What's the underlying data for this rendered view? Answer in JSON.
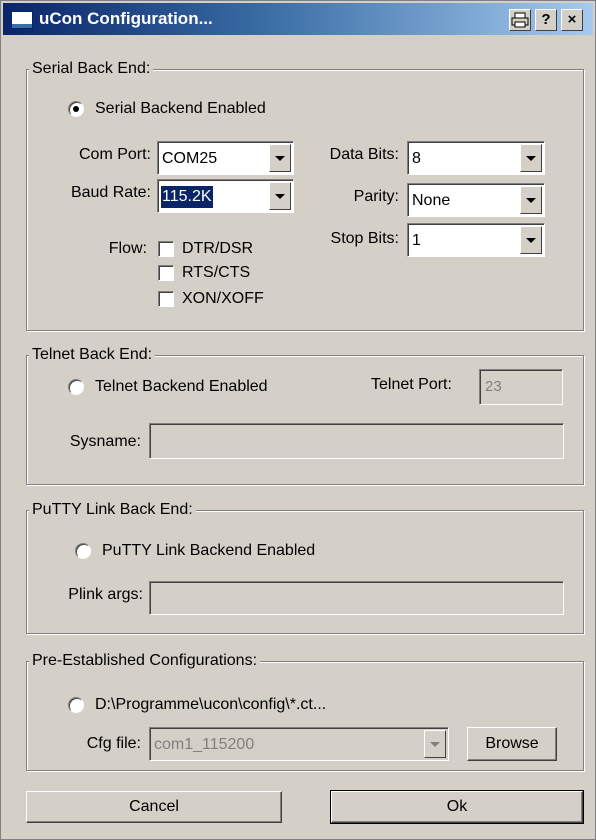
{
  "window": {
    "title": "uCon Configuration...",
    "help_label": "?",
    "close_label": "×"
  },
  "serial": {
    "legend": "Serial Back End:",
    "enable_label": "Serial Backend Enabled",
    "enabled": true,
    "com_port_label": "Com Port:",
    "com_port_value": "COM25",
    "baud_label": "Baud Rate:",
    "baud_value": "115.2K",
    "flow_label": "Flow:",
    "flow_options": [
      "DTR/DSR",
      "RTS/CTS",
      "XON/XOFF"
    ],
    "data_bits_label": "Data Bits:",
    "data_bits_value": "8",
    "parity_label": "Parity:",
    "parity_value": "None",
    "stop_bits_label": "Stop Bits:",
    "stop_bits_value": "1"
  },
  "telnet": {
    "legend": "Telnet Back End:",
    "enable_label": "Telnet Backend Enabled",
    "port_label": "Telnet Port:",
    "port_value": "23",
    "sysname_label": "Sysname:",
    "sysname_value": ""
  },
  "putty": {
    "legend": "PuTTY Link Back End:",
    "enable_label": "PuTTY Link Backend Enabled",
    "args_label": "Plink args:",
    "args_value": ""
  },
  "preset": {
    "legend": "Pre-Established Configurations:",
    "path_label": "D:\\Programme\\ucon\\config\\*.ct...",
    "cfg_label": "Cfg file:",
    "cfg_value": "com1_115200",
    "browse_label": "Browse"
  },
  "buttons": {
    "cancel": "Cancel",
    "ok": "Ok"
  }
}
